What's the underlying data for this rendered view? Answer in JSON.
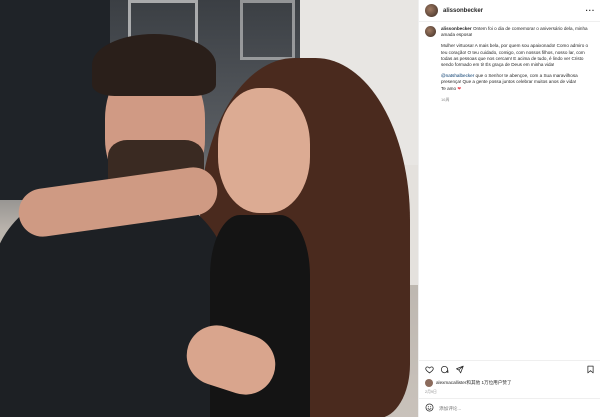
{
  "post": {
    "username": "alissonbecker",
    "more_icon": "ellipsis-icon",
    "caption": {
      "username": "alissonbecker",
      "line1": "Ontem foi o dia de comemorar o aniversário dela, minha amada esposa!",
      "para2": "Mulher virtuosa! A mais bela, por quem sou apaixonado! Como admiro o teu coração! O teu cuidado, comigo, com nossos filhos, nosso lar, com todas as pessoas que nos cercam! E acima de tudo, é lindo ver Cristo sendo formado em ti! És graça de Deus em minha vida!",
      "mention": "@natshalbecker",
      "para3": " que o Senhor te abençoe, com a Sua maravilhosa presença! Que a gente possa juntos celebrar muitos anos de vida!",
      "closing": "Te amo",
      "heart": "❤",
      "time_ago": "16周"
    },
    "actions": {
      "like_icon": "heart-icon",
      "comment_icon": "comment-icon",
      "share_icon": "share-icon",
      "save_icon": "bookmark-icon"
    },
    "liked_by": {
      "text": "alexmacallister和其他 1万位用户赞了"
    },
    "date": "2月9日",
    "comment": {
      "emoji_icon": "smiley-icon",
      "placeholder": "添加评论..."
    }
  }
}
